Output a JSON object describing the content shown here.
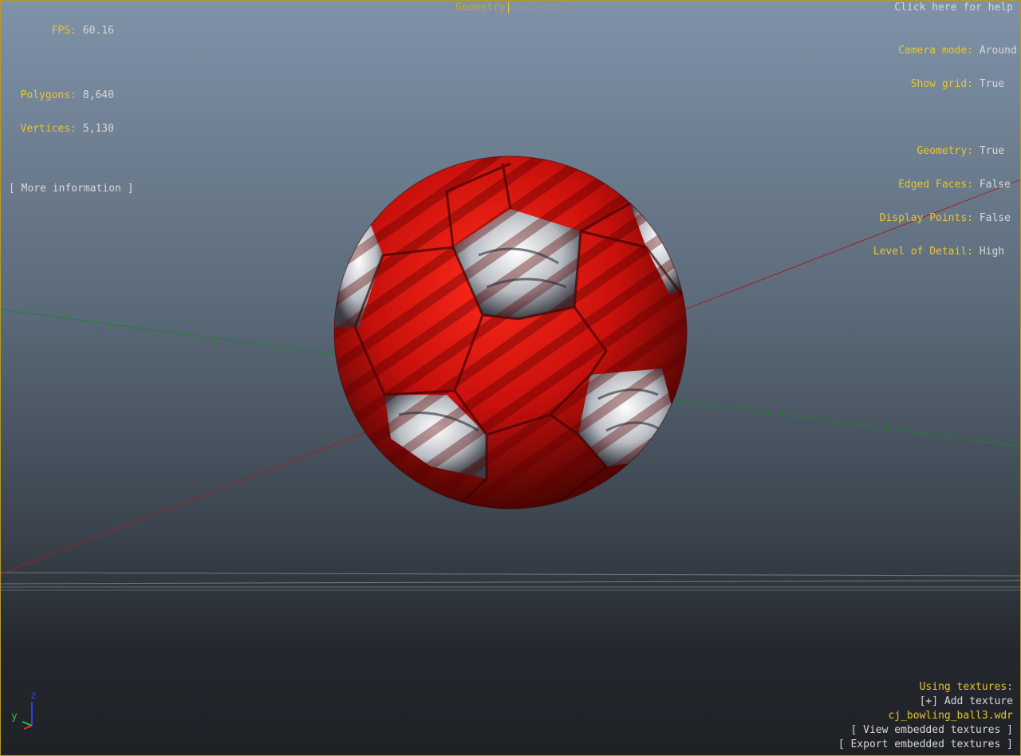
{
  "stats": {
    "fps_label": "FPS:",
    "fps_value": "60.16",
    "polygons_label": "Polygons:",
    "polygons_value": "8,640",
    "vertices_label": "Vertices:",
    "vertices_value": "5,130",
    "more_info": "[ More information ]"
  },
  "tabs": {
    "geometry": "Geometry",
    "separator": "|",
    "skeleton": "Skeleton"
  },
  "help": "Click here for help",
  "settings": [
    {
      "label": "Camera mode:",
      "value": "Around"
    },
    {
      "label": "Show grid:",
      "value": "True"
    },
    {
      "label": "Geometry:",
      "value": "True"
    },
    {
      "label": "Edged Faces:",
      "value": "False"
    },
    {
      "label": "Display Points:",
      "value": "False"
    },
    {
      "label": "Level of Detail:",
      "value": "High"
    }
  ],
  "textures": {
    "heading": "Using textures:",
    "add": "[+] Add texture",
    "file": "cj_bowling_ball3.wdr",
    "view": "[ View embedded textures ]",
    "export": "[ Export embedded textures ]"
  },
  "gizmo": {
    "z": "z",
    "y": "y"
  },
  "colors": {
    "accent": "#e8c530",
    "ball_red": "#c8100c",
    "ball_white": "#e6e6e6",
    "axis_x": "#a02020",
    "axis_y": "#208030"
  }
}
